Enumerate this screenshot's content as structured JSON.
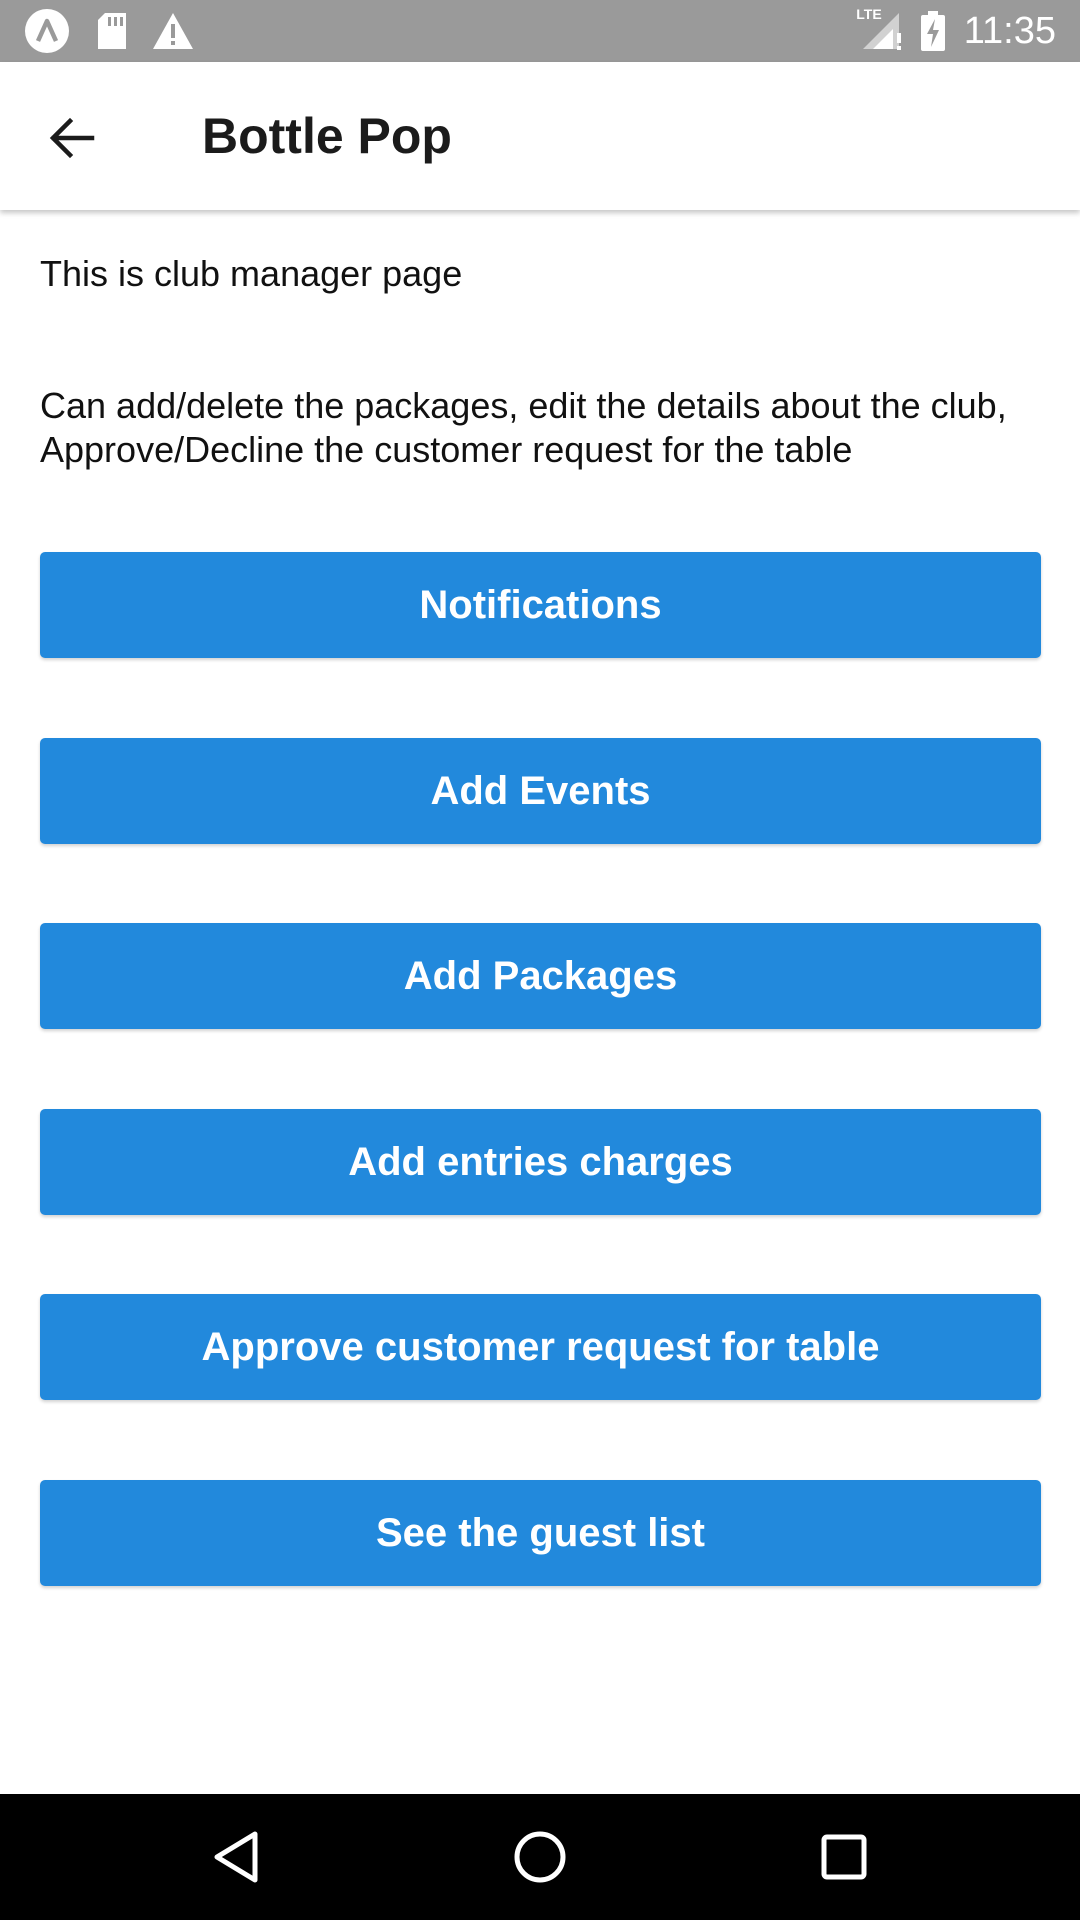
{
  "status_bar": {
    "time": "11:35",
    "network_label": "LTE",
    "icons": [
      "app-notification-icon",
      "sd-card-icon",
      "warning-icon",
      "lte-signal-icon",
      "battery-charging-icon"
    ]
  },
  "app_bar": {
    "title": "Bottle Pop",
    "back_icon": "arrow-back-icon"
  },
  "main": {
    "intro": "This is club manager page",
    "description": "Can add/delete the packages, edit the details about the club, Approve/Decline the customer request for the table",
    "buttons": [
      {
        "label": "Notifications"
      },
      {
        "label": "Add Events"
      },
      {
        "label": "Add Packages"
      },
      {
        "label": "Add entries charges"
      },
      {
        "label": "Approve customer request for table"
      },
      {
        "label": "See the guest list"
      }
    ]
  },
  "nav_bar": {
    "icons": [
      "back-triangle-icon",
      "home-circle-icon",
      "recents-square-icon"
    ]
  },
  "colors": {
    "status_bar": "#9a9a9a",
    "button": "#2289dc",
    "nav_bar": "#000000",
    "title_text": "#1b1b1b"
  }
}
